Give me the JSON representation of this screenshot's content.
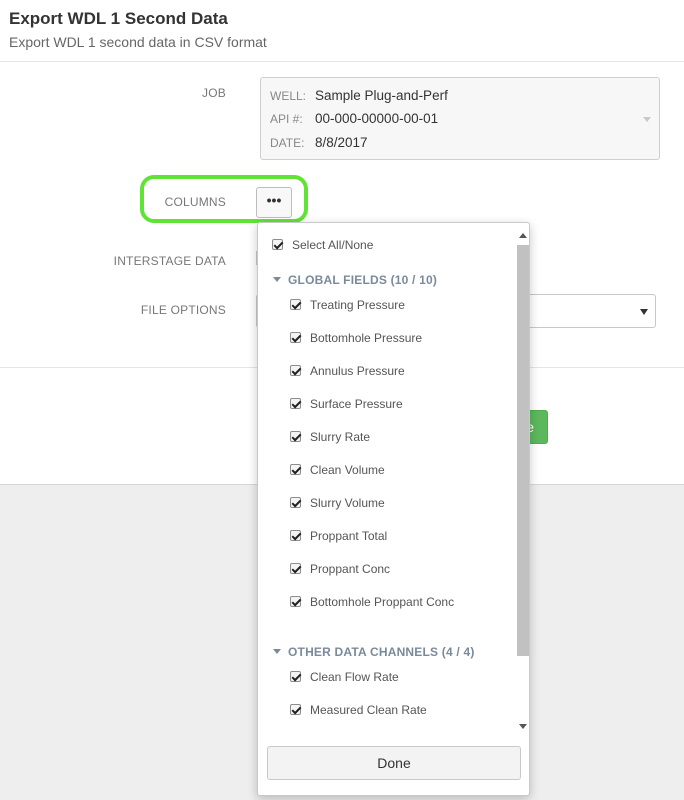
{
  "header": {
    "title": "Export WDL 1 Second Data",
    "subtitle": "Export WDL 1 second data in CSV format"
  },
  "form": {
    "job_label": "JOB",
    "columns_label": "COLUMNS",
    "interstage_label": "INTERSTAGE DATA",
    "file_options_label": "FILE OPTIONS",
    "columns_button_label": "•••",
    "green_button_label": "e"
  },
  "job": {
    "well_key": "WELL:",
    "well_value": "Sample Plug-and-Perf",
    "api_key": "API #:",
    "api_value": "00-000-00000-00-01",
    "date_key": "DATE:",
    "date_value": "8/8/2017"
  },
  "dropdown": {
    "select_all_label": "Select All/None",
    "groups": [
      {
        "title": "GLOBAL FIELDS (10 / 10)",
        "items": [
          "Treating Pressure",
          "Bottomhole Pressure",
          "Annulus Pressure",
          "Surface Pressure",
          "Slurry Rate",
          "Clean Volume",
          "Slurry Volume",
          "Proppant Total",
          "Proppant Conc",
          "Bottomhole Proppant Conc"
        ]
      },
      {
        "title": "OTHER DATA CHANNELS (4 / 4)",
        "items": [
          "Clean Flow Rate",
          "Measured Clean Rate"
        ]
      }
    ],
    "done_label": "Done"
  },
  "colors": {
    "highlight": "#5fe334",
    "primary_button": "#5cb85c",
    "group_header": "#7a8a9a"
  }
}
